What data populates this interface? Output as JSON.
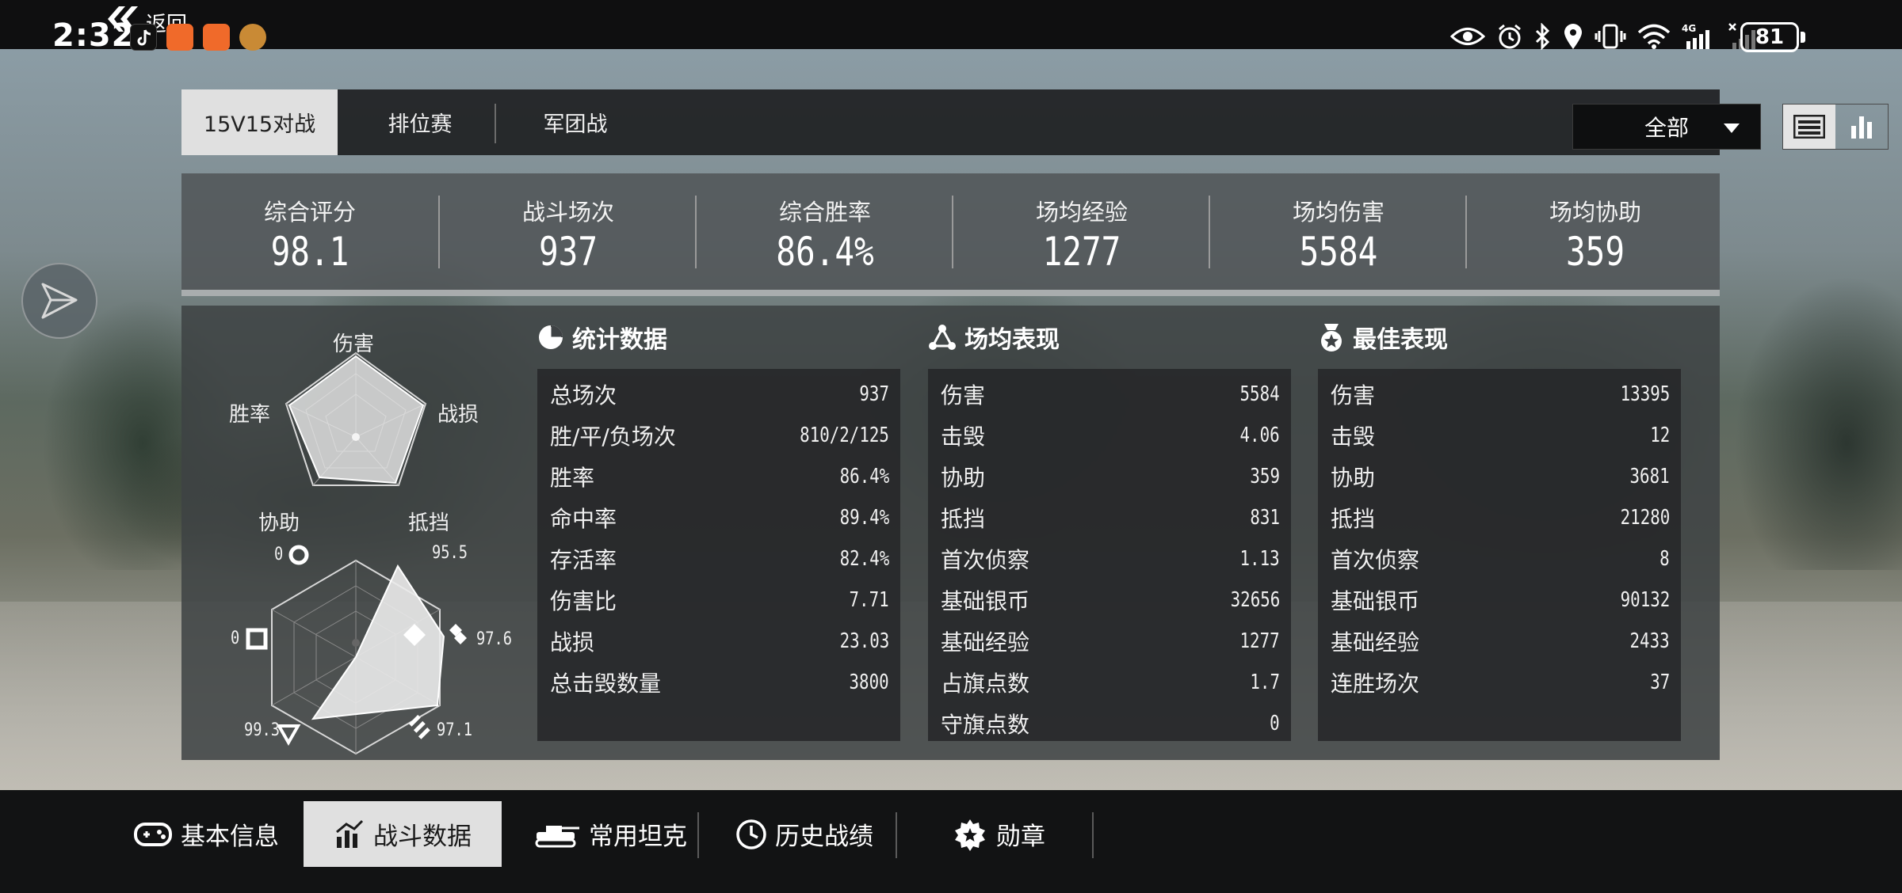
{
  "status_bar": {
    "time": "2:32",
    "back_label": "返回",
    "battery": "81"
  },
  "top_tabs": [
    {
      "label": "15V15对战",
      "active": true
    },
    {
      "label": "排位赛",
      "active": false
    },
    {
      "label": "军团战",
      "active": false
    }
  ],
  "filter": {
    "selected": "全部"
  },
  "summary": [
    {
      "label": "综合评分",
      "value": "98.1"
    },
    {
      "label": "战斗场次",
      "value": "937"
    },
    {
      "label": "综合胜率",
      "value": "86.4%"
    },
    {
      "label": "场均经验",
      "value": "1277"
    },
    {
      "label": "场均伤害",
      "value": "5584"
    },
    {
      "label": "场均协助",
      "value": "359"
    }
  ],
  "radar": {
    "pentagon_labels": [
      "伤害",
      "战损",
      "抵挡",
      "协助",
      "胜率"
    ],
    "hexagon_values": [
      {
        "icon": "diamond-icon",
        "value": "95.5"
      },
      {
        "icon": "double-diamond-icon",
        "value": "97.6"
      },
      {
        "icon": "triple-bar-icon",
        "value": "97.1"
      },
      {
        "icon": "triangle-icon",
        "value": "99.3"
      },
      {
        "icon": "square-icon",
        "value": "0"
      },
      {
        "icon": "ring-icon",
        "value": "0"
      }
    ]
  },
  "stats": {
    "title": "统计数据",
    "rows": [
      {
        "name": "总场次",
        "value": "937"
      },
      {
        "name": "胜/平/负场次",
        "value": "810/2/125"
      },
      {
        "name": "胜率",
        "value": "86.4%"
      },
      {
        "name": "命中率",
        "value": "89.4%"
      },
      {
        "name": "存活率",
        "value": "82.4%"
      },
      {
        "name": "伤害比",
        "value": "7.71"
      },
      {
        "name": "战损",
        "value": "23.03"
      },
      {
        "name": "总击毁数量",
        "value": "3800"
      }
    ]
  },
  "average": {
    "title": "场均表现",
    "rows": [
      {
        "name": "伤害",
        "value": "5584"
      },
      {
        "name": "击毁",
        "value": "4.06"
      },
      {
        "name": "协助",
        "value": "359"
      },
      {
        "name": "抵挡",
        "value": "831"
      },
      {
        "name": "首次侦察",
        "value": "1.13"
      },
      {
        "name": "基础银币",
        "value": "32656"
      },
      {
        "name": "基础经验",
        "value": "1277"
      },
      {
        "name": "占旗点数",
        "value": "1.7"
      },
      {
        "name": "守旗点数",
        "value": "0"
      }
    ]
  },
  "best": {
    "title": "最佳表现",
    "rows": [
      {
        "name": "伤害",
        "value": "13395"
      },
      {
        "name": "击毁",
        "value": "12"
      },
      {
        "name": "协助",
        "value": "3681"
      },
      {
        "name": "抵挡",
        "value": "21280"
      },
      {
        "name": "首次侦察",
        "value": "8"
      },
      {
        "name": "基础银币",
        "value": "90132"
      },
      {
        "name": "基础经验",
        "value": "2433"
      },
      {
        "name": "连胜场次",
        "value": "37"
      }
    ]
  },
  "bottom_nav": [
    {
      "label": "基本信息",
      "icon": "gamepad-icon",
      "active": false
    },
    {
      "label": "战斗数据",
      "icon": "bar-chart-icon",
      "active": true
    },
    {
      "label": "常用坦克",
      "icon": "tank-icon",
      "active": false
    },
    {
      "label": "历史战绩",
      "icon": "clock-icon",
      "active": false
    },
    {
      "label": "勋章",
      "icon": "medal-icon",
      "active": false
    }
  ]
}
